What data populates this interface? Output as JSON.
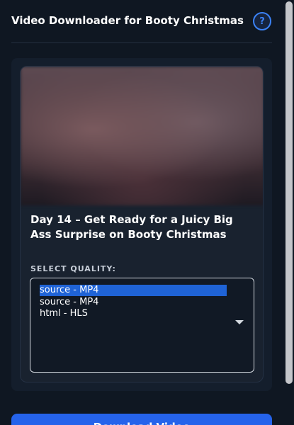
{
  "header": {
    "title": "Video Downloader for Booty Christmas",
    "help_label": "?"
  },
  "video": {
    "title": "Day 14 – Get Ready for a Juicy Big Ass Surprise on Booty Christmas",
    "thumbnail_icon": "blurred-thumbnail"
  },
  "quality": {
    "label": "SELECT QUALITY:",
    "options": [
      {
        "label": "source - MP4",
        "selected": true
      },
      {
        "label": "source - MP4",
        "selected": false
      },
      {
        "label": "html - HLS",
        "selected": false
      }
    ]
  },
  "actions": {
    "download_label": "Download Video"
  }
}
